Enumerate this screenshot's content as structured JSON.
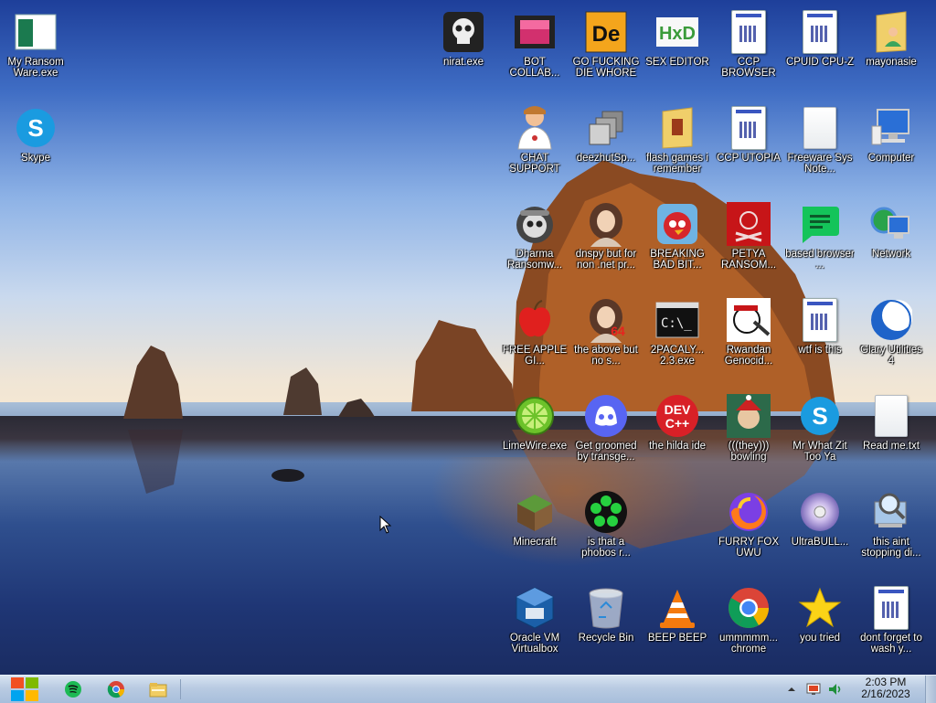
{
  "desktop": {
    "icons": [
      {
        "label": "My Ransom Ware.exe",
        "icon": "ransomware-window-icon"
      },
      {
        "label": "Skype",
        "icon": "skype-icon"
      },
      {
        "label": "nirat.exe",
        "icon": "skull-icon"
      },
      {
        "label": "BOT COLLAB...",
        "icon": "film-icon"
      },
      {
        "label": "GO FUCKING DIE WHORE",
        "icon": "de-icon"
      },
      {
        "label": "SEX EDITOR",
        "icon": "hxd-icon"
      },
      {
        "label": "CCP BROWSER",
        "icon": "app-document-icon"
      },
      {
        "label": "CPUID CPU-Z",
        "icon": "app-document-icon"
      },
      {
        "label": "mayonasie",
        "icon": "user-folder-icon"
      },
      {
        "label": "CHAT SUPPORT",
        "icon": "doctor-icon"
      },
      {
        "label": "deezhutSp...",
        "icon": "stacked-windows-icon"
      },
      {
        "label": "flash games i remember",
        "icon": "folder-icon"
      },
      {
        "label": "CCP UTOPIA",
        "icon": "app-document-icon"
      },
      {
        "label": "Freeware Sys Note...",
        "icon": "blank-document-icon"
      },
      {
        "label": "Computer",
        "icon": "computer-icon"
      },
      {
        "label": "Dharma Ransomw...",
        "icon": "skull-helmet-icon"
      },
      {
        "label": "dnspy but for non .net pr...",
        "icon": "portrait-icon"
      },
      {
        "label": "BREAKING BAD BIT...",
        "icon": "angry-bird-icon"
      },
      {
        "label": "PETYA RANSOM...",
        "icon": "petya-skull-icon"
      },
      {
        "label": "based browser ...",
        "icon": "green-chat-icon"
      },
      {
        "label": "Network",
        "icon": "network-icon"
      },
      {
        "label": "FREE APPLE GI...",
        "icon": "apple-icon"
      },
      {
        "label": "the above but no s...",
        "icon": "portrait-64-icon"
      },
      {
        "label": "2PACALY... 2.3.exe",
        "icon": "console-icon"
      },
      {
        "label": "Rwandan Genocid...",
        "icon": "meme-face-icon"
      },
      {
        "label": "wtf is this",
        "icon": "app-document-icon"
      },
      {
        "label": "Glary Utilities 4",
        "icon": "glary-moon-icon"
      },
      {
        "label": "LimeWire.exe",
        "icon": "limewire-icon"
      },
      {
        "label": "Get groomed by transge...",
        "icon": "discord-icon"
      },
      {
        "label": "the hilda ide",
        "icon": "devcpp-icon"
      },
      {
        "label": "(((they))) bowling",
        "icon": "elf-portrait-icon"
      },
      {
        "label": "Mr What Zit Too Ya",
        "icon": "skype-icon"
      },
      {
        "label": "Read me.txt",
        "icon": "blank-document-icon"
      },
      {
        "label": "Minecraft",
        "icon": "minecraft-block-icon"
      },
      {
        "label": "is that a phobos r...",
        "icon": "icq-flower-icon"
      },
      {
        "label": "FURRY FOX UWU",
        "icon": "firefox-icon"
      },
      {
        "label": "UltraBULL...",
        "icon": "disc-icon"
      },
      {
        "label": "this aint stopping di...",
        "icon": "magnifier-computer-icon"
      },
      {
        "label": "Oracle VM Virtualbox",
        "icon": "virtualbox-icon"
      },
      {
        "label": "Recycle Bin",
        "icon": "recycle-bin-icon"
      },
      {
        "label": "BEEP BEEP",
        "icon": "vlc-cone-icon"
      },
      {
        "label": "ummmmm... chrome",
        "icon": "chrome-icon"
      },
      {
        "label": "you tried",
        "icon": "star-icon"
      },
      {
        "label": "dont forget to wash y...",
        "icon": "app-document-icon"
      }
    ]
  },
  "taskbar": {
    "pinned": [
      {
        "icon": "spotify-icon"
      },
      {
        "icon": "chrome-icon"
      },
      {
        "icon": "file-explorer-icon"
      }
    ],
    "tray": {
      "icons": [
        "show-hidden-icons-arrow",
        "action-center-flag-icon",
        "volume-icon"
      ],
      "time": "2:03 PM",
      "date": "2/16/2023"
    }
  }
}
